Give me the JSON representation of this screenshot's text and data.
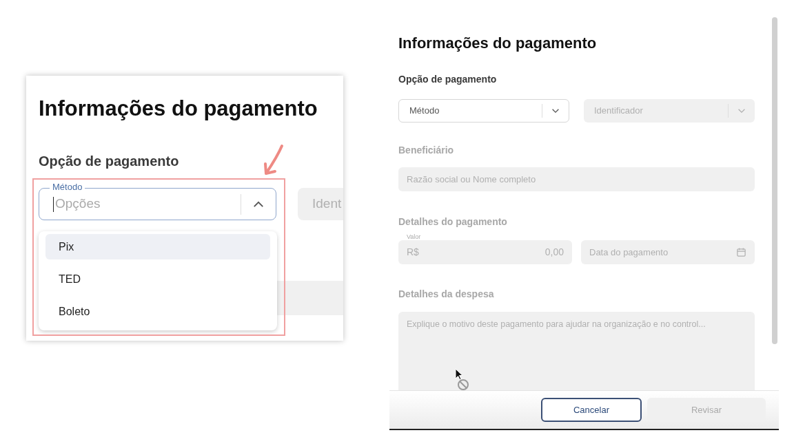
{
  "inset": {
    "title": "Informações do pagamento",
    "section": "Opção de pagamento",
    "method_select": {
      "label": "Método",
      "placeholder": "Opções",
      "expanded": true
    },
    "identifier_select": {
      "value": "Ident",
      "disabled": true
    },
    "options": [
      {
        "label": "Pix",
        "highlighted": true
      },
      {
        "label": "TED",
        "highlighted": false
      },
      {
        "label": "Boleto",
        "highlighted": false
      }
    ]
  },
  "form": {
    "title": "Informações do pagamento",
    "payment_option": {
      "heading": "Opção de pagamento",
      "method": {
        "placeholder": "Método",
        "disabled": false
      },
      "identifier": {
        "placeholder": "Identificador",
        "disabled": true
      }
    },
    "beneficiary": {
      "heading": "Beneficiário",
      "placeholder": "Razão social ou Nome completo",
      "disabled": true
    },
    "payment_details": {
      "heading": "Detalhes do pagamento",
      "amount": {
        "label": "Valor",
        "prefix": "R$",
        "placeholder": "0,00",
        "disabled": true
      },
      "date": {
        "placeholder": "Data do pagamento",
        "disabled": true
      }
    },
    "expense_details": {
      "heading": "Detalhes da despesa",
      "placeholder": "Explique o motivo deste pagamento para ajudar na organização e no control...",
      "disabled": true
    }
  },
  "buttons": [
    {
      "label": "Cancelar",
      "disabled": false
    },
    {
      "label": "Revisar",
      "disabled": true
    }
  ]
}
